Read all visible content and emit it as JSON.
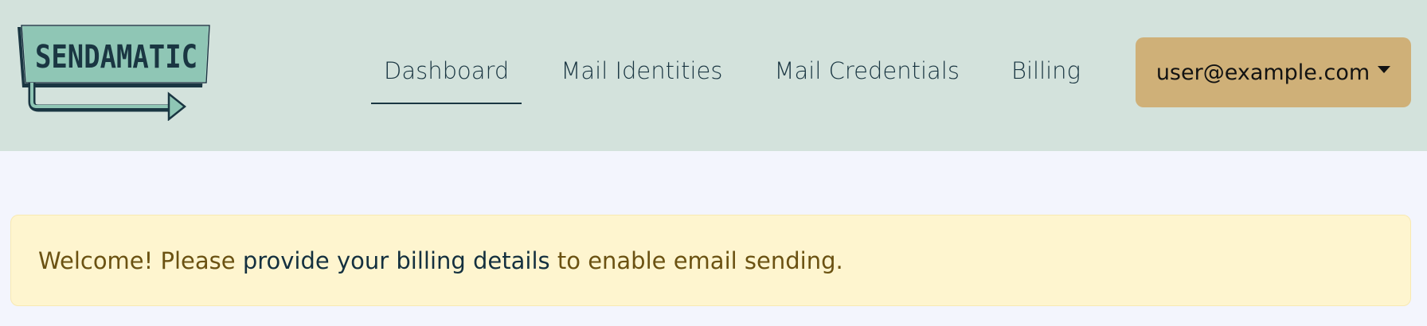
{
  "brand": {
    "logo_text": "SENDAMATIC"
  },
  "nav": {
    "items": [
      {
        "label": "Dashboard",
        "active": true
      },
      {
        "label": "Mail Identities",
        "active": false
      },
      {
        "label": "Mail Credentials",
        "active": false
      },
      {
        "label": "Billing",
        "active": false
      }
    ]
  },
  "user_menu": {
    "label": "user@example.com",
    "icon": "caret-down-icon"
  },
  "alert": {
    "prefix": "Welcome! Please ",
    "link_text": "provide your billing details",
    "suffix": " to enable email sending."
  },
  "colors": {
    "header_bg": "#d3e2dc",
    "page_bg": "#f3f5fd",
    "user_button_bg": "#cfb078",
    "alert_bg": "#fef5cf",
    "alert_text": "#6b5212",
    "link_text": "#14303f",
    "logo_fill": "#8fc6b5",
    "logo_ink": "#1a3642"
  }
}
